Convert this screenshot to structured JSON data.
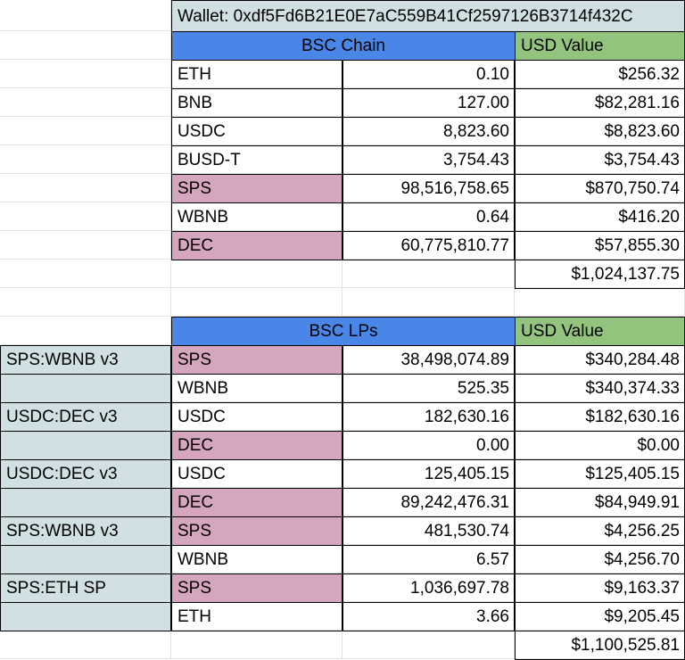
{
  "wallet": "Wallet: 0xdf5Fd6B21E0E7aC559B41Cf2597126B3714f432C",
  "chain": {
    "header": "BSC Chain",
    "usd_header": "USD Value",
    "rows": [
      {
        "token": "ETH",
        "amount": "0.10",
        "usd": "$256.32",
        "highlight": false
      },
      {
        "token": "BNB",
        "amount": "127.00",
        "usd": "$82,281.16",
        "highlight": false
      },
      {
        "token": "USDC",
        "amount": "8,823.60",
        "usd": "$8,823.60",
        "highlight": false
      },
      {
        "token": "BUSD-T",
        "amount": "3,754.43",
        "usd": "$3,754.43",
        "highlight": false
      },
      {
        "token": "SPS",
        "amount": "98,516,758.65",
        "usd": "$870,750.74",
        "highlight": true
      },
      {
        "token": "WBNB",
        "amount": "0.64",
        "usd": "$416.20",
        "highlight": false
      },
      {
        "token": "DEC",
        "amount": "60,775,810.77",
        "usd": "$57,855.30",
        "highlight": true
      }
    ],
    "total": "$1,024,137.75"
  },
  "lps": {
    "header": "BSC LPs",
    "usd_header": "USD Value",
    "rows": [
      {
        "pool": "SPS:WBNB v3",
        "token": "SPS",
        "amount": "38,498,074.89",
        "usd": "$340,284.48",
        "highlight": true
      },
      {
        "pool": "",
        "token": "WBNB",
        "amount": "525.35",
        "usd": "$340,374.33",
        "highlight": false
      },
      {
        "pool": "USDC:DEC v3",
        "token": "USDC",
        "amount": "182,630.16",
        "usd": "$182,630.16",
        "highlight": false
      },
      {
        "pool": "",
        "token": "DEC",
        "amount": "0.00",
        "usd": "$0.00",
        "highlight": true
      },
      {
        "pool": "USDC:DEC v3",
        "token": "USDC",
        "amount": "125,405.15",
        "usd": "$125,405.15",
        "highlight": false
      },
      {
        "pool": "",
        "token": "DEC",
        "amount": "89,242,476.31",
        "usd": "$84,949.91",
        "highlight": true
      },
      {
        "pool": "SPS:WBNB v3",
        "token": "SPS",
        "amount": "481,530.74",
        "usd": "$4,256.25",
        "highlight": true
      },
      {
        "pool": "",
        "token": "WBNB",
        "amount": "6.57",
        "usd": "$4,256.70",
        "highlight": false
      },
      {
        "pool": "SPS:ETH SP",
        "token": "SPS",
        "amount": "1,036,697.78",
        "usd": "$9,163.37",
        "highlight": true
      },
      {
        "pool": "",
        "token": "ETH",
        "amount": "3.66",
        "usd": "$9,205.45",
        "highlight": false
      }
    ],
    "total": "$1,100,525.81"
  },
  "colors": {
    "header_blue": "#4a86e8",
    "header_green": "#93c47d",
    "token_pink": "#d5a6bd",
    "pool_teal": "#d0e0e3"
  }
}
